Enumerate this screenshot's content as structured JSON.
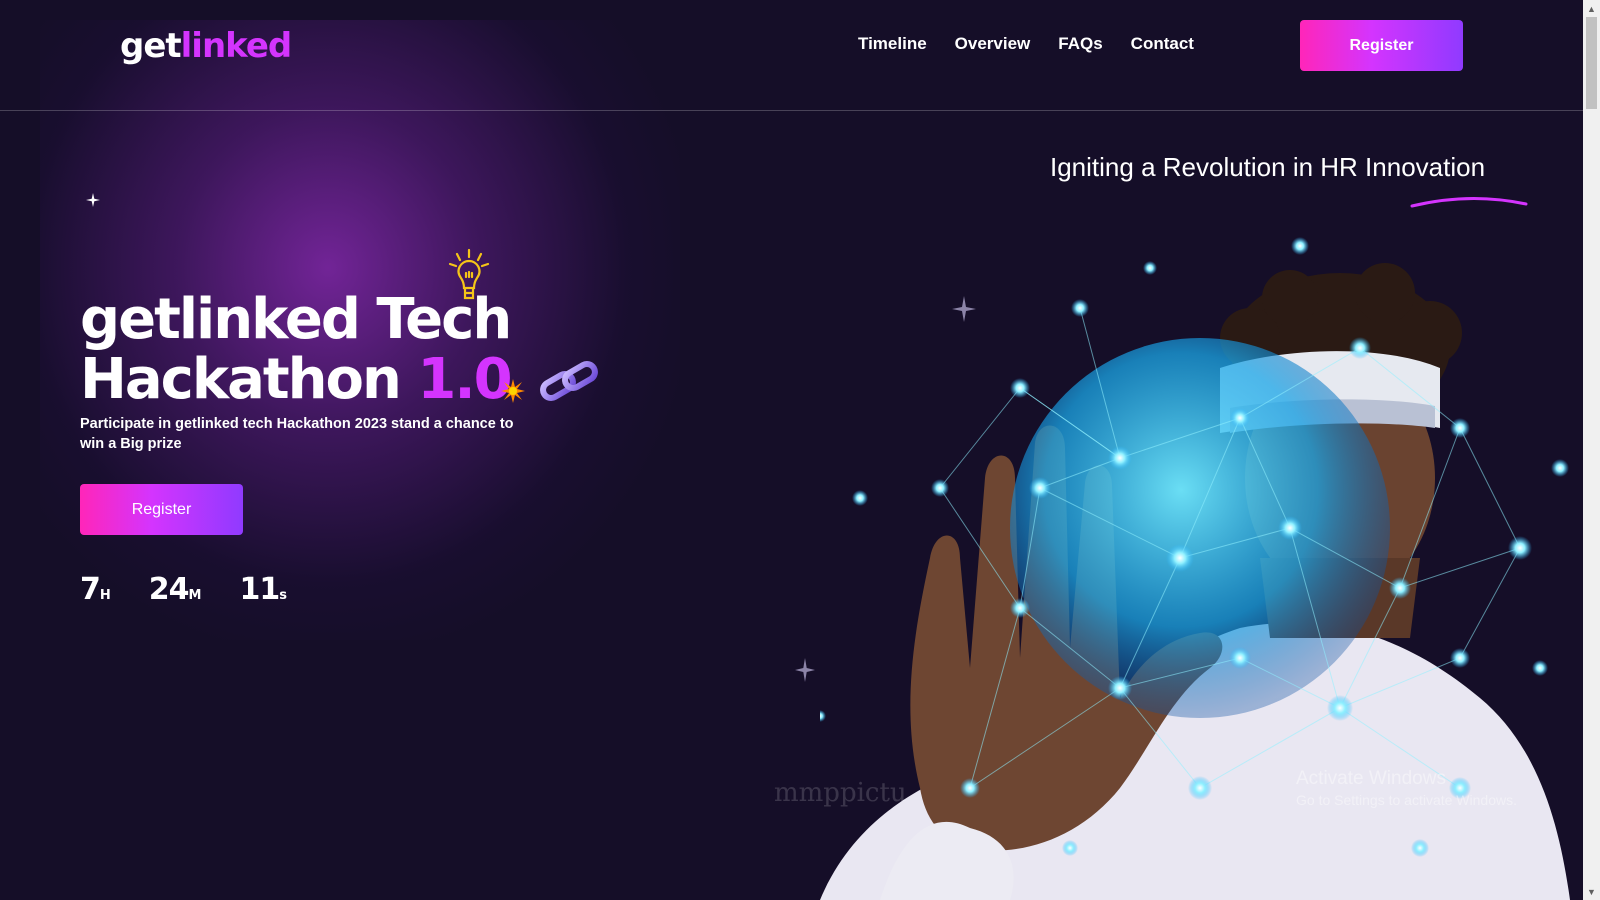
{
  "header": {
    "logo_part1": "get",
    "logo_part2": "linked",
    "nav": [
      {
        "label": "Timeline"
      },
      {
        "label": "Overview"
      },
      {
        "label": "FAQs"
      },
      {
        "label": "Contact"
      }
    ],
    "register_label": "Register"
  },
  "hero": {
    "title_line1": "getlinked Tech",
    "title_line2_text": "Hackathon ",
    "title_version": "1.0",
    "subtitle": "Participate in getlinked tech Hackathon 2023 stand a chance to win a Big prize",
    "register_label": "Register",
    "countdown": [
      {
        "value": "7",
        "unit": "H"
      },
      {
        "value": "24",
        "unit": "M"
      },
      {
        "value": "11",
        "unit": "s"
      }
    ],
    "tagline": "Igniting a Revolution in HR Innovation"
  },
  "overlays": {
    "watermark": "mmppictu",
    "activate_title": "Activate Windows",
    "activate_subtitle": "Go to Settings to activate Windows."
  },
  "icons": {
    "bulb": "lightbulb-icon",
    "chain": "chain-link-icon",
    "burst": "spark-burst-icon",
    "sparkle": "sparkle-star-icon"
  },
  "colors": {
    "background": "#150e28",
    "accent": "#d434fe",
    "gradient_start": "#ff26b9",
    "gradient_end": "#903aff"
  }
}
